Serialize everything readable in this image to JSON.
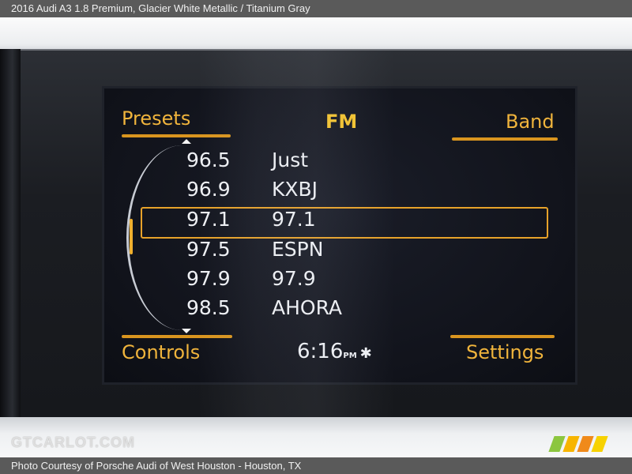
{
  "caption": {
    "top": "2016 Audi A3 1.8 Premium,  Glacier White Metallic / Titanium Gray",
    "bottom": "Photo Courtesy of Porsche Audi of West Houston - Houston, TX"
  },
  "watermark": {
    "text": "GTCARLOT.COM"
  },
  "radio": {
    "band": "FM",
    "softkeys": {
      "top_left": "Presets",
      "top_right": "Band",
      "bottom_left": "Controls",
      "bottom_right": "Settings"
    },
    "stations": [
      {
        "freq": "96.5",
        "name": "Just"
      },
      {
        "freq": "96.9",
        "name": "KXBJ"
      },
      {
        "freq": "97.1",
        "name": "97.1"
      },
      {
        "freq": "97.5",
        "name": "ESPN"
      },
      {
        "freq": "97.9",
        "name": "97.9"
      },
      {
        "freq": "98.5",
        "name": "AHORA"
      }
    ],
    "selected_index": 2,
    "clock": {
      "time": "6:16",
      "ampm": "PM"
    },
    "status_icons": [
      "bluetooth-icon"
    ],
    "colors": {
      "accent": "#f0b43c",
      "band_label": "#f4c42f",
      "text": "#eef0f4"
    }
  }
}
